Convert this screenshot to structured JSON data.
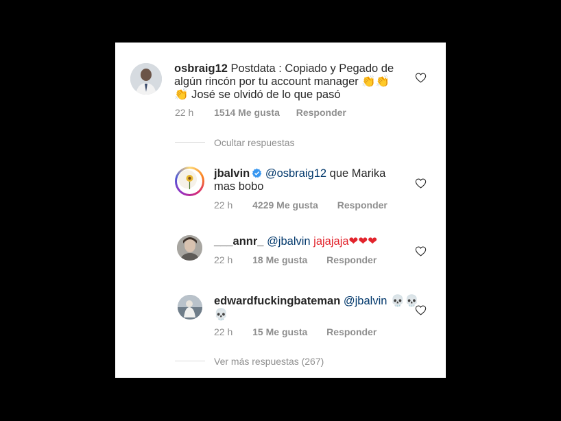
{
  "comments": [
    {
      "username": "osbraig12",
      "text": "Postdata : Copiado y Pegado de algún rincón por tu account manager 👏👏👏 José se olvidó de lo que pasó",
      "time": "22 h",
      "likes": "1514 Me gusta",
      "reply": "Responder"
    },
    {
      "username": "jbalvin",
      "verified": true,
      "mention": "@osbraig12",
      "text": " que Marika mas bobo",
      "time": "22 h",
      "likes": "4229 Me gusta",
      "reply": "Responder"
    },
    {
      "username": "___annr_",
      "mention": "@jbalvin",
      "text": " jajajaja❤❤❤",
      "time": "22 h",
      "likes": "18 Me gusta",
      "reply": "Responder"
    },
    {
      "username": "edwardfuckingbateman",
      "mention": "@jbalvin",
      "text": " 💀💀💀",
      "time": "22 h",
      "likes": "15 Me gusta",
      "reply": "Responder"
    }
  ],
  "hide_replies": "Ocultar respuestas",
  "view_more_replies": "Ver más respuestas (267)",
  "colors": {
    "background": "#000000",
    "card": "#ffffff",
    "text": "#262626",
    "meta": "#8e8e8e",
    "mention": "#00376b",
    "verified": "#3897f0"
  },
  "icons": [
    "heart-outline-icon",
    "verified-badge-icon"
  ]
}
